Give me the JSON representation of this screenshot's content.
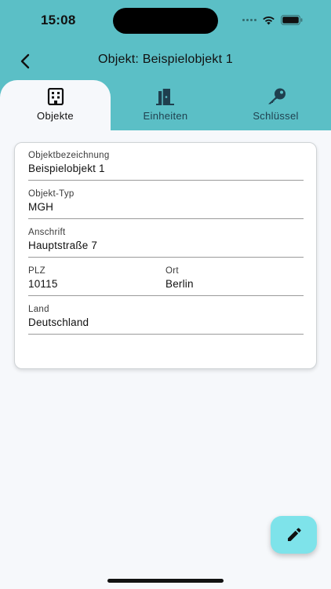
{
  "status_bar": {
    "time": "15:08",
    "icons": [
      "signal-dots-icon",
      "wifi-icon",
      "battery-icon"
    ]
  },
  "header": {
    "title": "Objekt: Beispielobjekt 1",
    "back_icon": "chevron-left-icon",
    "background_color": "#5bbfc6"
  },
  "tabs": [
    {
      "label": "Objekte",
      "icon": "building-icon",
      "active": true
    },
    {
      "label": "Einheiten",
      "icon": "door-icon",
      "active": false
    },
    {
      "label": "Schlüssel",
      "icon": "key-icon",
      "active": false
    }
  ],
  "card": {
    "fields": [
      {
        "label": "Objektbezeichnung",
        "value": "Beispielobjekt 1"
      },
      {
        "label": "Objekt-Typ",
        "value": "MGH"
      },
      {
        "label": "Anschrift",
        "value": "Hauptstraße 7"
      },
      {
        "label": "PLZ",
        "value": "10115"
      },
      {
        "label": "Ort",
        "value": "Berlin"
      },
      {
        "label": "Land",
        "value": "Deutschland"
      }
    ]
  },
  "fab": {
    "icon": "pencil-icon",
    "color": "#7ee3ea"
  }
}
